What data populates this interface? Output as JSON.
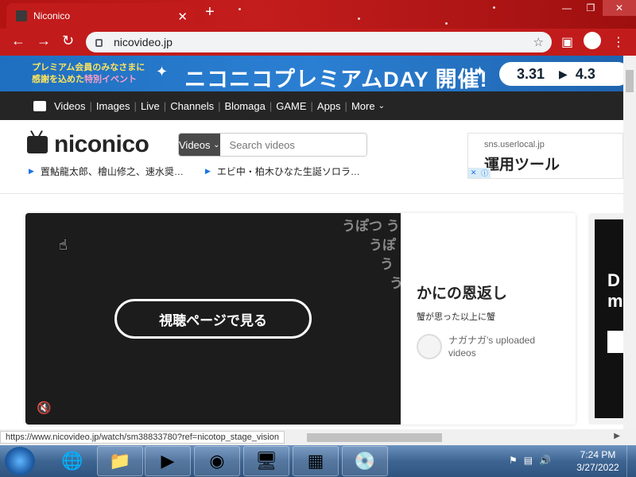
{
  "browser": {
    "tab_title": "Niconico",
    "tab_close": "✕",
    "new_tab": "+",
    "url": "nicovideo.jp",
    "status_url": "https://www.nicovideo.jp/watch/sm38833780?ref=nicotop_stage_vision"
  },
  "banner": {
    "line1": "プレミアム会員のみなさまに",
    "line2a": "感謝を込めた",
    "line2b": "特別イベント",
    "title": "ニコニコプレミアムDAY 開催!",
    "date_start": "3.31",
    "date_end": "4.3"
  },
  "nav": {
    "items": [
      "Videos",
      "Images",
      "Live",
      "Channels",
      "Blomaga",
      "GAME",
      "Apps",
      "More"
    ]
  },
  "header": {
    "logo_text": "niconico",
    "search_category": "Videos",
    "search_placeholder": "Search videos",
    "trends": [
      "置鮎龍太郎、檜山修之、速水奨…",
      "エビ中・柏木ひなた生誕ソロラ…"
    ]
  },
  "ad": {
    "domain": "sns.userlocal.jp",
    "headline": "運用ツール"
  },
  "stage": {
    "danmaku": [
      "うぽつ う",
      "うぽ",
      "う",
      "う"
    ],
    "watch_button": "視聴ページで見る",
    "video_title": "かにの恩返し",
    "video_desc": "蟹が思った以上に蟹",
    "uploader": "ナガナガ's uploaded videos"
  },
  "side_card": {
    "line1": "D",
    "line2": "m"
  },
  "taskbar": {
    "time": "7:24 PM",
    "date": "3/27/2022"
  },
  "colors": {
    "chrome_red": "#c21b1b",
    "nav_dark": "#252525",
    "banner_blue": "#2b7fd2"
  }
}
